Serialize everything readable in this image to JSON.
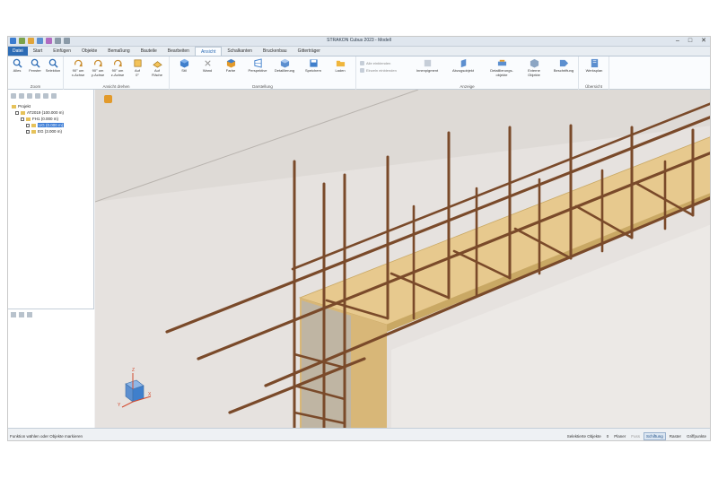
{
  "app": {
    "title": "STRAKON Cubus 2023 - Modell"
  },
  "tabs": [
    {
      "label": "Datei"
    },
    {
      "label": "Start"
    },
    {
      "label": "Einfügen"
    },
    {
      "label": "Objekte"
    },
    {
      "label": "Bemaßung"
    },
    {
      "label": "Bauteile"
    },
    {
      "label": "Bearbeiten"
    },
    {
      "label": "Ansicht"
    },
    {
      "label": "Schalkanten"
    },
    {
      "label": "Bruckenbau"
    },
    {
      "label": "Gitterträger"
    }
  ],
  "ribbon": {
    "zoom": {
      "label": "Zoom",
      "buttons": [
        "Alles",
        "Fenster",
        "Selektion"
      ]
    },
    "rotate": {
      "label": "Ansicht drehen",
      "buttons": [
        "90° um\nx-Achse",
        "90° um\ny-Achse",
        "90° um\nz-Achse",
        "Auf\n0°",
        "Auf\nFläche"
      ]
    },
    "display": {
      "label": "Darstellung",
      "buttons": [
        "Stil",
        "Wand",
        "Farbe",
        "Perspektive",
        "Detaillierung",
        "Speichern",
        "Laden"
      ]
    },
    "show": {
      "label": "Anzeige",
      "small": [
        "Alle einblenden",
        "Einzeln einblenden"
      ],
      "buttons": [
        "Innenpigment",
        "Abzugsobjekt",
        "Detaillierungs-\nobjekte",
        "Externe\nObjekte",
        "Beschriftung"
      ]
    },
    "overview": {
      "label": "Übersicht",
      "buttons": [
        "Werksplan"
      ]
    }
  },
  "tree": {
    "items": [
      {
        "label": "Projekt"
      },
      {
        "label": "AT2019 (100.000 m)"
      },
      {
        "label": "FH1 (0.000 m)"
      },
      {
        "label": "UG (0.000 m)"
      },
      {
        "label": "EG (3.000 m)"
      }
    ]
  },
  "status": {
    "hint": "Funktion wählen oder Objekte markieren",
    "selected": "Selektierte Objekte",
    "count": "0",
    "toggles": [
      "Planer",
      "Fuss",
      "Schiftung",
      "Raster",
      "Griffpunkte"
    ]
  },
  "axes": {
    "z": "Z",
    "x": "X",
    "y": "Y"
  },
  "colors": {
    "accent": "#2d6cb5",
    "rebar": "#7a4a2a",
    "timber": "#e7c98e"
  }
}
